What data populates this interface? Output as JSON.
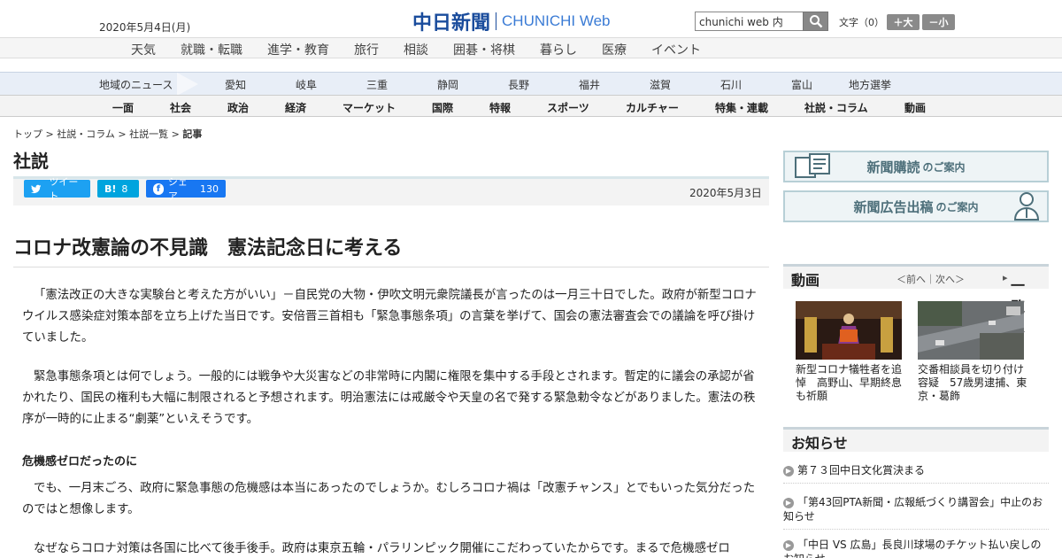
{
  "header": {
    "date": "2020年5月4日(月)",
    "logo_jp": "中日新聞",
    "logo_en": "CHUNICHI Web",
    "search_value": "chunichi web 内",
    "font_size_label": "文字（0）",
    "bigger_label": "＋大",
    "smaller_label": "－小"
  },
  "nav_primary": [
    "天気",
    "就職・転職",
    "進学・教育",
    "旅行",
    "相談",
    "囲碁・将棋",
    "暮らし",
    "医療",
    "イベント"
  ],
  "nav_region": {
    "label": "地域のニュース",
    "items": [
      "愛知",
      "岐阜",
      "三重",
      "静岡",
      "長野",
      "福井",
      "滋賀",
      "石川",
      "富山",
      "地方選挙"
    ]
  },
  "nav_sections": [
    "一面",
    "社会",
    "政治",
    "経済",
    "マーケット",
    "国際",
    "特報",
    "スポーツ",
    "カルチャー",
    "特集・連載",
    "社説・コラム",
    "動画"
  ],
  "breadcrumb": {
    "items": [
      "トップ",
      "社説・コラム",
      "社説一覧"
    ],
    "current": "記事",
    "sep": " > "
  },
  "section_title": "社説",
  "share": {
    "tweet": "ツイート",
    "hatena_label": "B!",
    "hatena_count": "8",
    "fb_label": "シェア",
    "fb_count": "130"
  },
  "article": {
    "date": "2020年5月3日",
    "headline": "コロナ改憲論の不見識　憲法記念日に考える",
    "p1": "「憲法改正の大きな実験台と考えた方がいい」－自民党の大物・伊吹文明元衆院議長が言ったのは一月三十日でした。政府が新型コロナウイルス感染症対策本部を立ち上げた当日です。安倍晋三首相も「緊急事態条項」の言葉を挙げて、国会の憲法審査会での議論を呼び掛けていました。",
    "p2": "緊急事態条項とは何でしょう。一般的には戦争や大災害などの非常時に内閣に権限を集中する手段とされます。暫定的に議会の承認が省かれたり、国民の権利も大幅に制限されると予想されます。明治憲法には戒厳令や天皇の名で発する緊急勅令などがありました。憲法の秩序が一時的に止まる“劇薬”といえそうです。",
    "subhead": "危機感ゼロだったのに",
    "p3": "でも、一月末ごろ、政府に緊急事態の危機感は本当にあったのでしょうか。むしろコロナ禍は「改憲チャンス」とでもいった気分だったのではと想像します。",
    "p4": "なぜならコロナ対策は各国に比べて後手後手。政府は東京五輪・パラリンピック開催にこだわっていたからです。まるで危機感ゼロ"
  },
  "sidebar": {
    "banner1_main": "新聞購読",
    "banner1_sub": "のご案内",
    "banner2_main": "新聞広告出稿",
    "banner2_sub": "のご案内",
    "video_title": "動画",
    "video_nav": "＜前へ｜次へ＞",
    "video_all": "一覧へ",
    "videos": [
      {
        "caption": "新型コロナ犠牲者を追悼　高野山、早期終息も祈願"
      },
      {
        "caption": "交番相談員を切り付け容疑　57歳男逮捕、東京・葛飾"
      }
    ],
    "notice_title": "お知らせ",
    "notices": [
      "第７３回中日文化賞決まる",
      "「第43回PTA新聞・広報紙づくり講習会」中止のお知らせ",
      "「中日 VS 広島」長良川球場のチケット払い戻しのお知らせ"
    ]
  },
  "colors": {
    "brand": "#1a4c9c",
    "twitter": "#1da1f2",
    "hatena": "#00a4de",
    "facebook": "#1877f2"
  }
}
